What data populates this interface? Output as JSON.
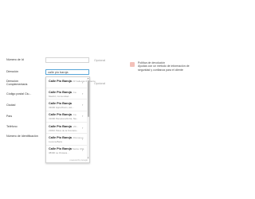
{
  "form": {
    "tax_id_label": "Número de Id",
    "address_label": "Dirección",
    "address_value": "calle pio baroja",
    "address_complement_label": "Dirección Complementaria",
    "postcode_label": "Código postal Ciu...",
    "city_label": "Ciudad",
    "country_label": "País",
    "phone_label": "Teléfono",
    "identification_label": "Número de Identificación",
    "optional_text": "Opcional"
  },
  "suggestions": [
    {
      "bold": "Calle Pio Baroja",
      "detail": "29 Vallecas Poniente",
      "sub": ""
    },
    {
      "bold": "Calle Pio Baroja",
      "detail": ", Ca",
      "sub": "Madrid, Comunidad..."
    },
    {
      "bold": "Calle Pio Baroja",
      "detail": "",
      "sub": "33006 Gijón/Xixón, Ast..."
    },
    {
      "bold": "Calle Pio Baroja",
      "detail": ", Ca",
      "sub": "31006 Pamplona/Iruña, Na..."
    },
    {
      "bold": "Calle Pio Baroja",
      "detail": ", Vill...",
      "sub": "21810 Palos de la Frontera..."
    },
    {
      "bold": "Calle Pio Baroja",
      "detail": ", Rincones",
      "sub": "Lucena-Baza"
    },
    {
      "bold": "Calle Pio Baroja",
      "detail": " Santa Uña",
      "sub": "38300 La Orotava..."
    }
  ],
  "suggestions_footer": "powered by Google",
  "policy": {
    "title": "Política de devolución",
    "line1": "Ayudas con un método de información de",
    "line2": "seguridad y confianza para el cliente"
  },
  "icons": {
    "policy_icon": "refund-policy-icon",
    "chevron": "chevron-right-icon"
  },
  "colors": {
    "focus_border": "#5aa7d9",
    "policy_icon": "#f3c1b9"
  }
}
